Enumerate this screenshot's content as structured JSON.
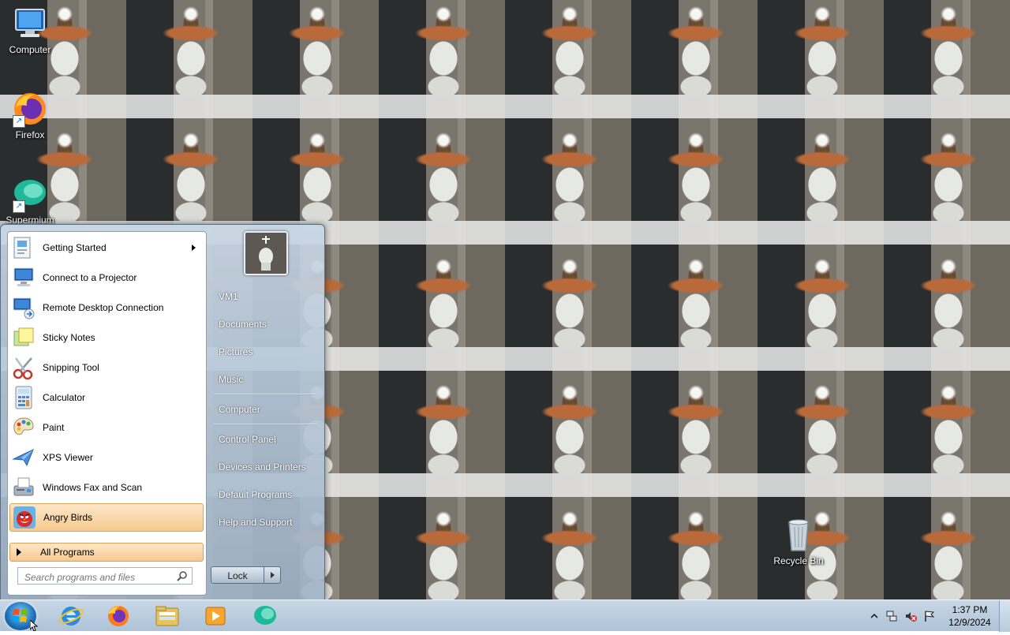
{
  "desktop": {
    "icons": [
      {
        "label": "Computer",
        "icon": "computer-icon"
      },
      {
        "label": "Firefox",
        "icon": "firefox-icon"
      },
      {
        "label": "Supermium",
        "icon": "supermium-icon"
      },
      {
        "label": "Recycle Bin",
        "icon": "recycle-bin-icon"
      }
    ],
    "wallpaper": "tiled-photo"
  },
  "start_menu": {
    "programs": [
      {
        "label": "Getting Started",
        "icon": "getting-started-icon",
        "has_submenu": true
      },
      {
        "label": "Connect to a Projector",
        "icon": "projector-icon"
      },
      {
        "label": "Remote Desktop Connection",
        "icon": "remote-desktop-icon"
      },
      {
        "label": "Sticky Notes",
        "icon": "sticky-notes-icon"
      },
      {
        "label": "Snipping Tool",
        "icon": "scissors-icon"
      },
      {
        "label": "Calculator",
        "icon": "calculator-icon"
      },
      {
        "label": "Paint",
        "icon": "paint-palette-icon"
      },
      {
        "label": "XPS Viewer",
        "icon": "xps-viewer-icon"
      },
      {
        "label": "Windows Fax and Scan",
        "icon": "fax-icon"
      },
      {
        "label": "Angry Birds",
        "icon": "angry-birds-icon",
        "highlighted": true
      }
    ],
    "all_programs_label": "All Programs",
    "search": {
      "placeholder": "Search programs and files"
    },
    "places": [
      {
        "label": "VM1"
      },
      {
        "label": "Documents"
      },
      {
        "label": "Pictures"
      },
      {
        "label": "Music"
      },
      {
        "label": "Computer"
      },
      {
        "label": "Control Panel"
      },
      {
        "label": "Devices and Printers"
      },
      {
        "label": "Default Programs"
      },
      {
        "label": "Help and Support"
      }
    ],
    "power_button_label": "Lock"
  },
  "taskbar": {
    "pinned": [
      {
        "name": "internet-explorer-icon"
      },
      {
        "name": "firefox-icon"
      },
      {
        "name": "windows-explorer-icon"
      },
      {
        "name": "media-player-icon"
      },
      {
        "name": "supermium-icon"
      }
    ],
    "tray_icons": [
      "show-hidden-icons-chevron",
      "network-icon",
      "volume-muted-icon",
      "action-center-flag-icon"
    ],
    "clock": {
      "time": "1:37 PM",
      "date": "12/9/2024"
    }
  },
  "colors": {
    "accent": "#1b6fb8",
    "highlight": "#f6c98e",
    "taskbar": "#aec3d8"
  }
}
